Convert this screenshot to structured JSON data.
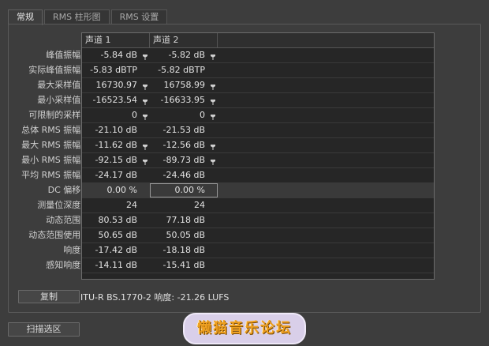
{
  "tabs": [
    "常规",
    "RMS 柱形图",
    "RMS 设置"
  ],
  "columns": [
    "声道 1",
    "声道 2"
  ],
  "rows": [
    {
      "label": "峰值振幅:",
      "ch1": "-5.84 dB",
      "ch2": "-5.82 dB",
      "pin": true
    },
    {
      "label": "实际峰值振幅:",
      "ch1": "-5.83 dBTP",
      "ch2": "-5.82 dBTP",
      "pin": false
    },
    {
      "label": "最大采样值:",
      "ch1": "16730.97",
      "ch2": "16758.99",
      "pin": true
    },
    {
      "label": "最小采样值:",
      "ch1": "-16523.54",
      "ch2": "-16633.95",
      "pin": true
    },
    {
      "label": "可限制的采样:",
      "ch1": "0",
      "ch2": "0",
      "pin": true
    },
    {
      "label": "总体 RMS 振幅:",
      "ch1": "-21.10 dB",
      "ch2": "-21.53 dB",
      "pin": false
    },
    {
      "label": "最大 RMS 振幅:",
      "ch1": "-11.62 dB",
      "ch2": "-12.56 dB",
      "pin": true
    },
    {
      "label": "最小 RMS 振幅:",
      "ch1": "-92.15 dB",
      "ch2": "-89.73 dB",
      "pin": true
    },
    {
      "label": "平均 RMS 振幅:",
      "ch1": "-24.17 dB",
      "ch2": "-24.46 dB",
      "pin": false
    },
    {
      "label": "DC 偏移:",
      "ch1": "0.00 %",
      "ch2": "0.00 %",
      "pin": false
    },
    {
      "label": "测量位深度:",
      "ch1": "24",
      "ch2": "24",
      "pin": false
    },
    {
      "label": "动态范围:",
      "ch1": "80.53 dB",
      "ch2": "77.18 dB",
      "pin": false
    },
    {
      "label": "动态范围使用:",
      "ch1": "50.65 dB",
      "ch2": "50.05 dB",
      "pin": false
    },
    {
      "label": "响度:",
      "ch1": "-17.42 dB",
      "ch2": "-18.18 dB",
      "pin": false
    },
    {
      "label": "感知响度:",
      "ch1": "-14.11 dB",
      "ch2": "-15.41 dB",
      "pin": false
    }
  ],
  "copy_label": "复制",
  "loudness_text": "ITU-R BS.1770-2 响度: -21.26 LUFS",
  "scan_label": "扫描选区",
  "watermark_text": "懒猫音乐论坛"
}
